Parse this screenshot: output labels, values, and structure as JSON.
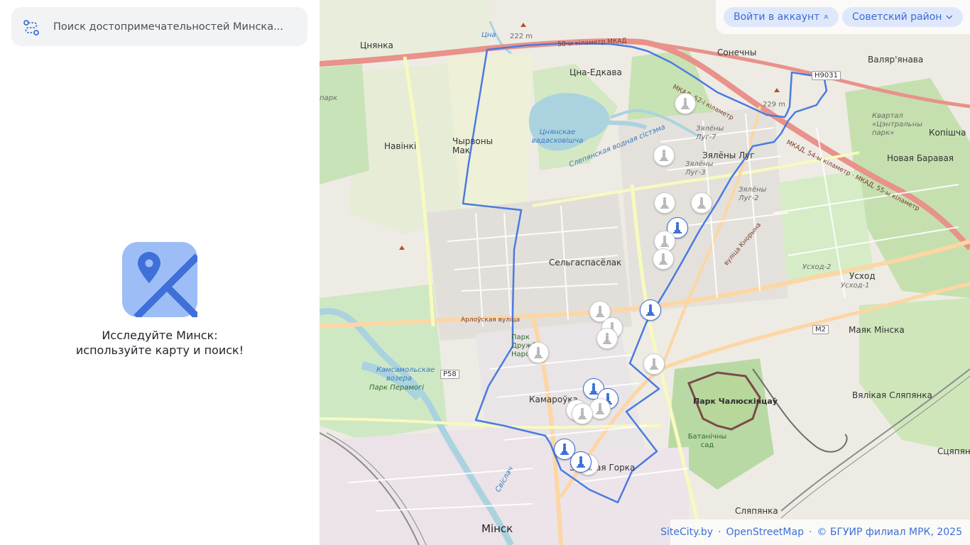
{
  "search": {
    "placeholder": "Поиск достопримечательностей Минска..."
  },
  "empty_state": {
    "line1": "Исследуйте Минск:",
    "line2": "используйте карту и поиск!"
  },
  "header": {
    "login_label": "Войти в аккаунт",
    "district_label": "Советский район"
  },
  "attribution": {
    "sitecity": "SiteCity.by",
    "osm": "OpenStreetMap",
    "copyright": "© БГУИР филиал МРК, 2025"
  },
  "map": {
    "labels": {
      "tsnyanka": "Цнянка",
      "tsna": "Цна",
      "elev222": "222 m",
      "tsna_edkava": "Цна-Едкава",
      "sonechny": "Сонечны",
      "valyaryanava": "Валяр'янава",
      "h9031": "Н9031",
      "elev229": "229 m",
      "mkad52": "МКАД, 52-і кіламетр",
      "mkad50": "50-ы кіламетр МКАД",
      "mkad54": "МКАД, 54-ы кіламетр · МКАД, 55-ы кіламетр",
      "park_left": "парк",
      "navinki": "Навінкі",
      "chyrvony_mak": "Чырвоны Мак",
      "reservoir": "Цнянскае вадасховішча",
      "water_system": "Слепянская водная сістэма",
      "zyaleny_lug": "Зялёны Луг",
      "zyaleny_lug7": "Зялёны Луг-7",
      "zyaleny_lug3": "Зялёны Луг-3",
      "zyaleny_lug2": "Зялёны Луг-2",
      "kvartal": "Квартал «Цэнтральны парк»",
      "kopishcha": "Копішча",
      "novaya_baravaya": "Новая Баравая",
      "selgasaselak": "Сельгаспасёлак",
      "usxod": "Усход",
      "usxod2": "Усход-2",
      "usxod1": "Усход-1",
      "kolasa": "вуліца Кнорына",
      "arlouskaya": "Арлоўская вуліца",
      "park_druzhby": "Парк Дружбы Народаў",
      "mayak_minska": "Маяк Мінска",
      "m2": "М2",
      "p58": "Р58",
      "kamsamolskae": "Камсамольскае возера",
      "park_peramogi": "Парк Перамогі",
      "kamarouka": "Камароўка",
      "park_chalyuskintsau": "Парк Чалюскінцаў",
      "vyalikaya_slyapyanka": "Вялікая Сляпянка",
      "batanichny": "Батанічны сад",
      "zolataya_gorka": "Залатая Горка",
      "slyapyanka": "Сляпянка",
      "minsk": "Мінск",
      "svislach": "Свіслач",
      "slyapyanka_right": "Сцяпянка"
    }
  },
  "colors": {
    "accent": "#3f6fd8",
    "pill_bg": "#dfe8fb",
    "boundary": "#4a7be0",
    "motorway": "#e8928a"
  },
  "icons": {
    "route": "route-icon",
    "user": "user-icon",
    "chevron": "chevron-down-icon",
    "empty": "map-placeholder-icon",
    "marker": "monument-icon"
  }
}
